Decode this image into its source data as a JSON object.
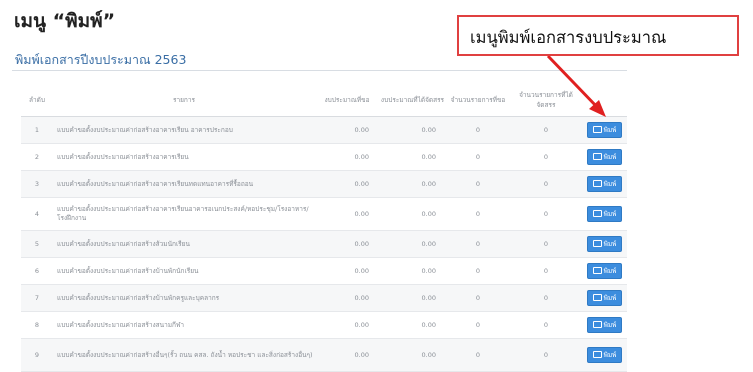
{
  "slide_title": "เมนู “พิมพ์”",
  "callout": "เมนูพิมพ์เอกสารงบประมาณ",
  "colors": {
    "accent": "#3c8dde",
    "callout_border": "#e04040",
    "arrow": "#e02020",
    "title_link": "#3a6ea5"
  },
  "panel": {
    "title": "พิมพ์เอกสารปีงบประมาณ 2563",
    "headers": [
      "ลำดับ",
      "รายการ",
      "งบประมาณที่ขอ",
      "งบประมาณที่ได้จัดสรร",
      "จำนวนรายการที่ขอ",
      "จำนวนรายการที่ได้จัดสรร"
    ],
    "print_label": "พิมพ์",
    "print_icon": "printer-icon",
    "rows": [
      {
        "no": "1",
        "name": "แบบคำขอตั้งงบประมาณค่าก่อสร้างอาคารเรียน อาคารประกอบ",
        "req": "0.00",
        "alloc": "0.00",
        "req_n": "0",
        "alloc_n": "0"
      },
      {
        "no": "2",
        "name": "แบบคำขอตั้งงบประมาณค่าก่อสร้างอาคารเรียน",
        "req": "0.00",
        "alloc": "0.00",
        "req_n": "0",
        "alloc_n": "0"
      },
      {
        "no": "3",
        "name": "แบบคำขอตั้งงบประมาณค่าก่อสร้างอาคารเรียนทดแทนอาคารที่รื้อถอน",
        "req": "0.00",
        "alloc": "0.00",
        "req_n": "0",
        "alloc_n": "0"
      },
      {
        "no": "4",
        "name": "แบบคำขอตั้งงบประมาณค่าก่อสร้างอาคารเรียนอาคารอเนกประสงค์/หอประชุม/โรงอาหาร/โรงฝึกงาน",
        "req": "0.00",
        "alloc": "0.00",
        "req_n": "0",
        "alloc_n": "0"
      },
      {
        "no": "5",
        "name": "แบบคำขอตั้งงบประมาณค่าก่อสร้างส้วมนักเรียน",
        "req": "0.00",
        "alloc": "0.00",
        "req_n": "0",
        "alloc_n": "0"
      },
      {
        "no": "6",
        "name": "แบบคำขอตั้งงบประมาณค่าก่อสร้างบ้านพักนักเรียน",
        "req": "0.00",
        "alloc": "0.00",
        "req_n": "0",
        "alloc_n": "0"
      },
      {
        "no": "7",
        "name": "แบบคำขอตั้งงบประมาณค่าก่อสร้างบ้านพักครูและบุคลากร",
        "req": "0.00",
        "alloc": "0.00",
        "req_n": "0",
        "alloc_n": "0"
      },
      {
        "no": "8",
        "name": "แบบคำขอตั้งงบประมาณค่าก่อสร้างสนามกีฬา",
        "req": "0.00",
        "alloc": "0.00",
        "req_n": "0",
        "alloc_n": "0"
      },
      {
        "no": "9",
        "name": "แบบคำขอตั้งงบประมาณค่าก่อสร้างอื่นๆ(รั้ว ถนน คสล. ถังน้ำ หอประชา และสิ่งก่อสร้างอื่นๆ)",
        "req": "0.00",
        "alloc": "0.00",
        "req_n": "0",
        "alloc_n": "0"
      }
    ]
  }
}
